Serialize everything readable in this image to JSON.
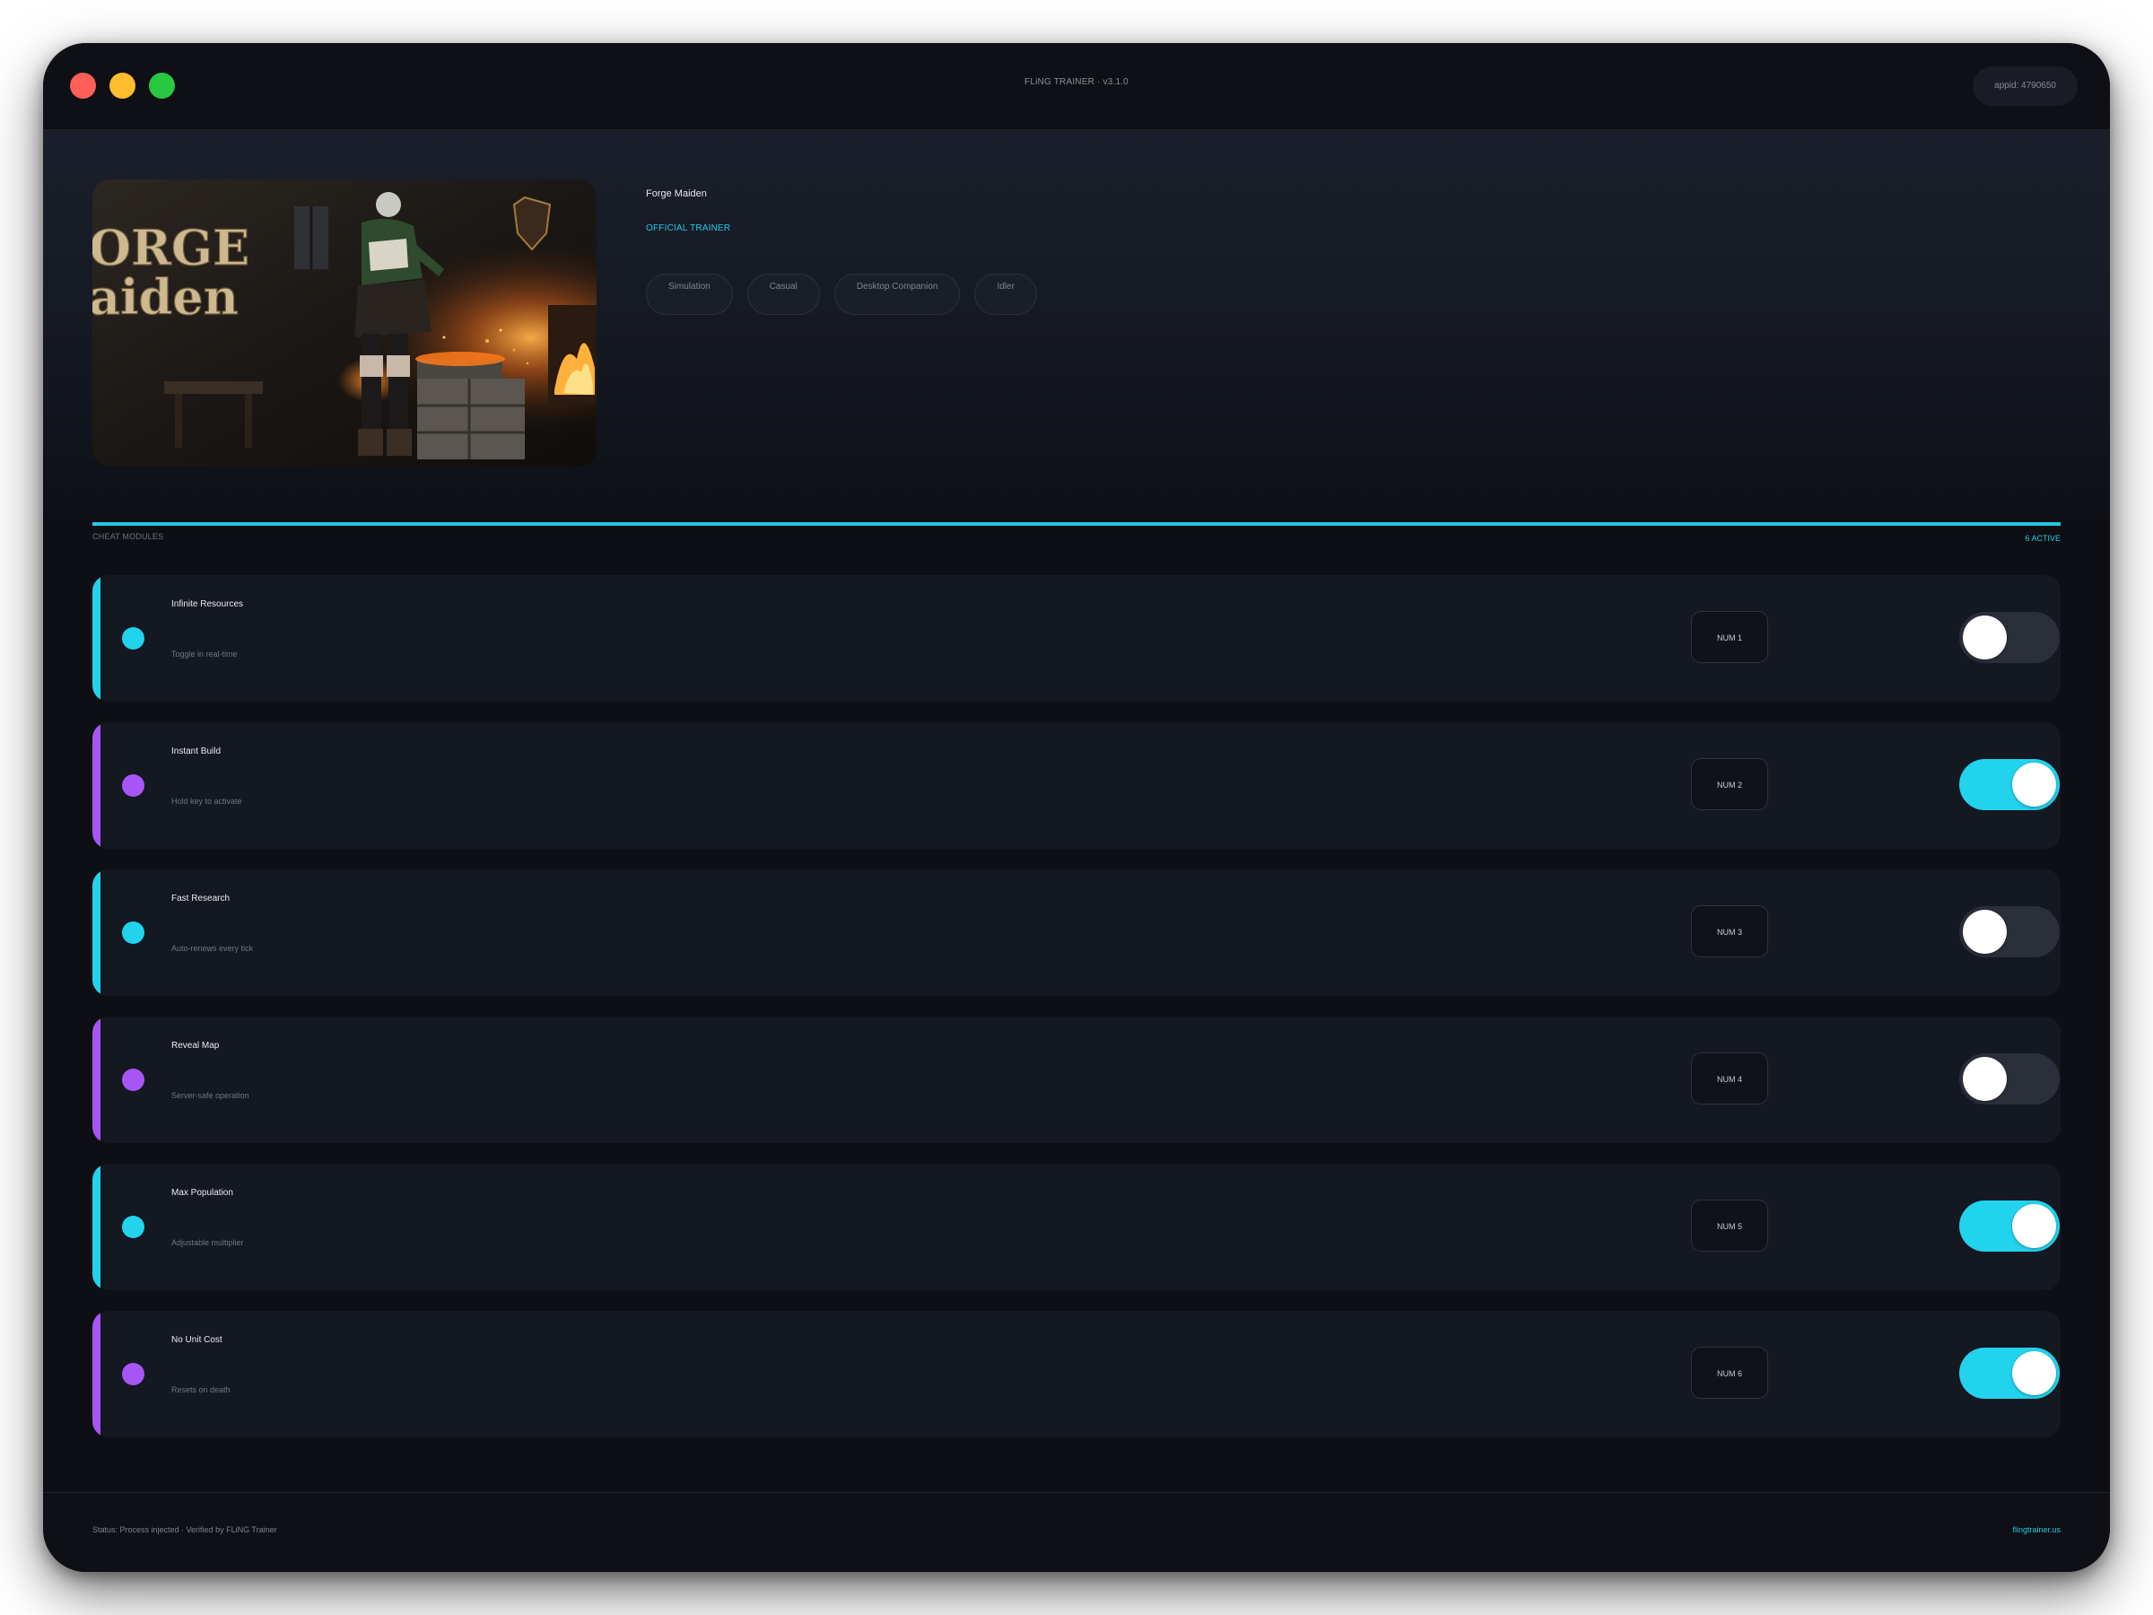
{
  "window": {
    "title": "FLiNG TRAINER · v3.1.0",
    "appid": "appid: 4790650"
  },
  "game": {
    "name": "Forge Maiden",
    "badge": "OFFICIAL TRAINER",
    "cover_text_line1": "ORGE",
    "cover_text_line2": "aiden",
    "tags": [
      "Simulation",
      "Casual",
      "Desktop Companion",
      "Idler"
    ]
  },
  "modules_section": {
    "label": "CHEAT MODULES",
    "active_count": "6 ACTIVE"
  },
  "modules": [
    {
      "name": "Infinite Resources",
      "desc": "Toggle in real-time",
      "hotkey": "NUM 1",
      "enabled": false,
      "accent": "#22d3ee"
    },
    {
      "name": "Instant Build",
      "desc": "Hold key to activate",
      "hotkey": "NUM 2",
      "enabled": true,
      "accent": "#a855f7"
    },
    {
      "name": "Fast Research",
      "desc": "Auto-renews every tick",
      "hotkey": "NUM 3",
      "enabled": false,
      "accent": "#22d3ee"
    },
    {
      "name": "Reveal Map",
      "desc": "Server-safe operation",
      "hotkey": "NUM 4",
      "enabled": false,
      "accent": "#a855f7"
    },
    {
      "name": "Max Population",
      "desc": "Adjustable multiplier",
      "hotkey": "NUM 5",
      "enabled": true,
      "accent": "#22d3ee"
    },
    {
      "name": "No Unit Cost",
      "desc": "Resets on death",
      "hotkey": "NUM 6",
      "enabled": true,
      "accent": "#a855f7"
    }
  ],
  "footer": {
    "status": "Status: Process injected · Verified by FLiNG Trainer",
    "site": "flingtrainer.us"
  },
  "colors": {
    "accent_cyan": "#22d3ee",
    "accent_purple": "#a855f7",
    "background": "#0d0f14"
  }
}
